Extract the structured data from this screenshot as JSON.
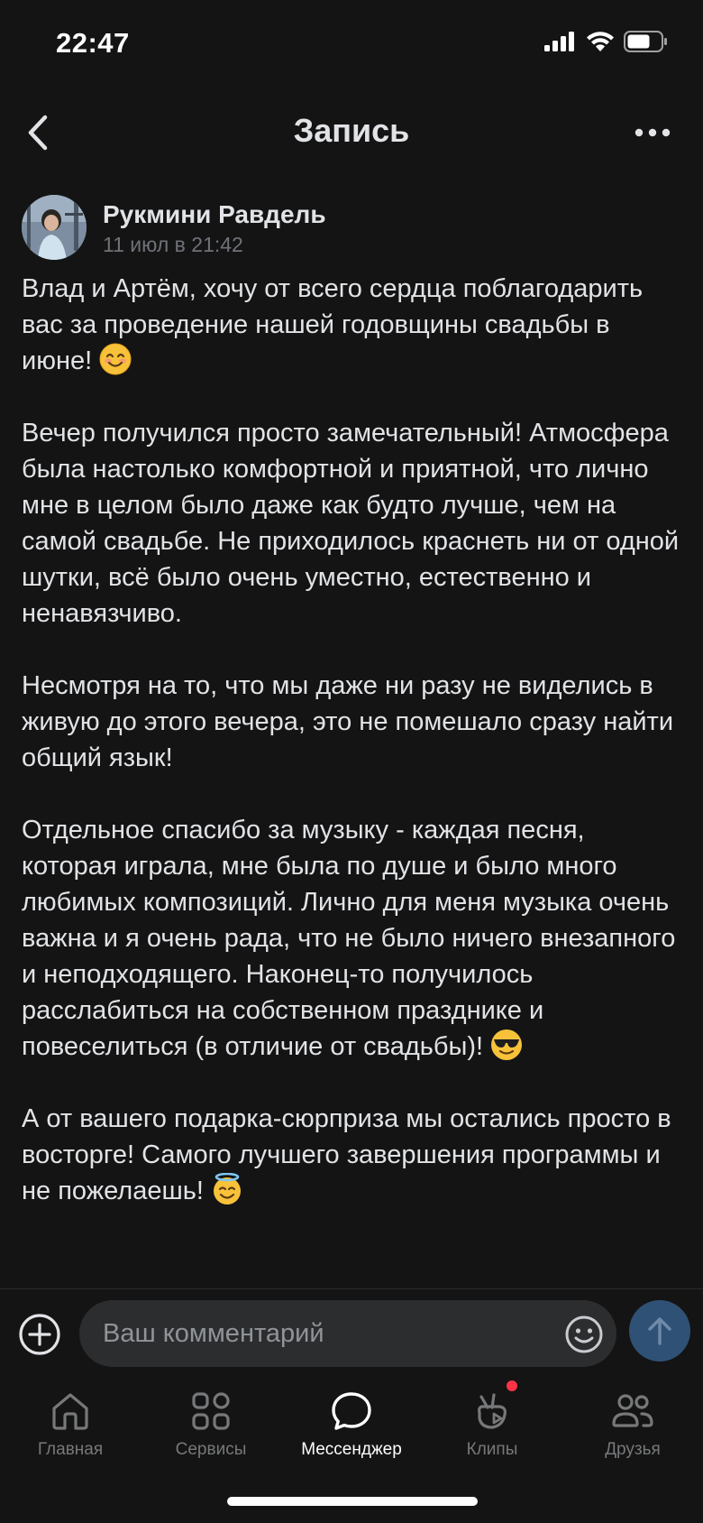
{
  "status_bar": {
    "time": "22:47"
  },
  "nav": {
    "title": "Запись",
    "back_icon": "chevron-left-icon",
    "more_icon": "more-horizontal-icon"
  },
  "post": {
    "author": "Рукмини Равдель",
    "date": "11 июл в 21:42",
    "paragraphs": [
      {
        "text": "Влад и Артём, хочу от всего сердца поблагодарить вас за проведение нашей годовщины свадьбы в июне! ",
        "emoji": "smiling-face-icon"
      },
      {
        "text": "Вечер получился просто замечательный! Атмосфера была настолько комфортной и приятной, что лично мне в целом было даже как будто лучше, чем на самой свадьбе. Не приходилось краснеть ни от одной шутки, всё было очень уместно, естественно и ненавязчиво."
      },
      {
        "text": "Несмотря на то, что мы даже ни разу не виделись в живую до этого вечера, это не помешало сразу найти общий язык!"
      },
      {
        "text": "Отдельное спасибо за музыку - каждая песня, которая играла, мне была по душе и было много любимых композиций. Лично для меня музыка очень важна и я очень рада, что не было ничего внезапного и неподходящего. Наконец-то получилось расслабиться на собственном празднике и повеселиться (в отличие от свадьбы)! ",
        "emoji": "sunglasses-face-icon"
      },
      {
        "text": "А от вашего подарка-сюрприза мы остались просто в восторге! Самого лучшего завершения программы и не пожелаешь! ",
        "emoji": "halo-face-icon"
      }
    ]
  },
  "comment": {
    "placeholder": "Ваш комментарий"
  },
  "tabbar": {
    "tabs": [
      {
        "label": "Главная",
        "icon": "home-icon",
        "active": false
      },
      {
        "label": "Сервисы",
        "icon": "services-grid-icon",
        "active": false
      },
      {
        "label": "Мессенджер",
        "icon": "message-bubble-icon",
        "active": true
      },
      {
        "label": "Клипы",
        "icon": "clips-icon",
        "active": false,
        "badge": true
      },
      {
        "label": "Друзья",
        "icon": "friends-icon",
        "active": false
      }
    ]
  },
  "colors": {
    "background": "#141414",
    "text": "#e1e3e6",
    "muted": "#76787a",
    "accent": "#2f5175",
    "badge": "#ff3347"
  }
}
